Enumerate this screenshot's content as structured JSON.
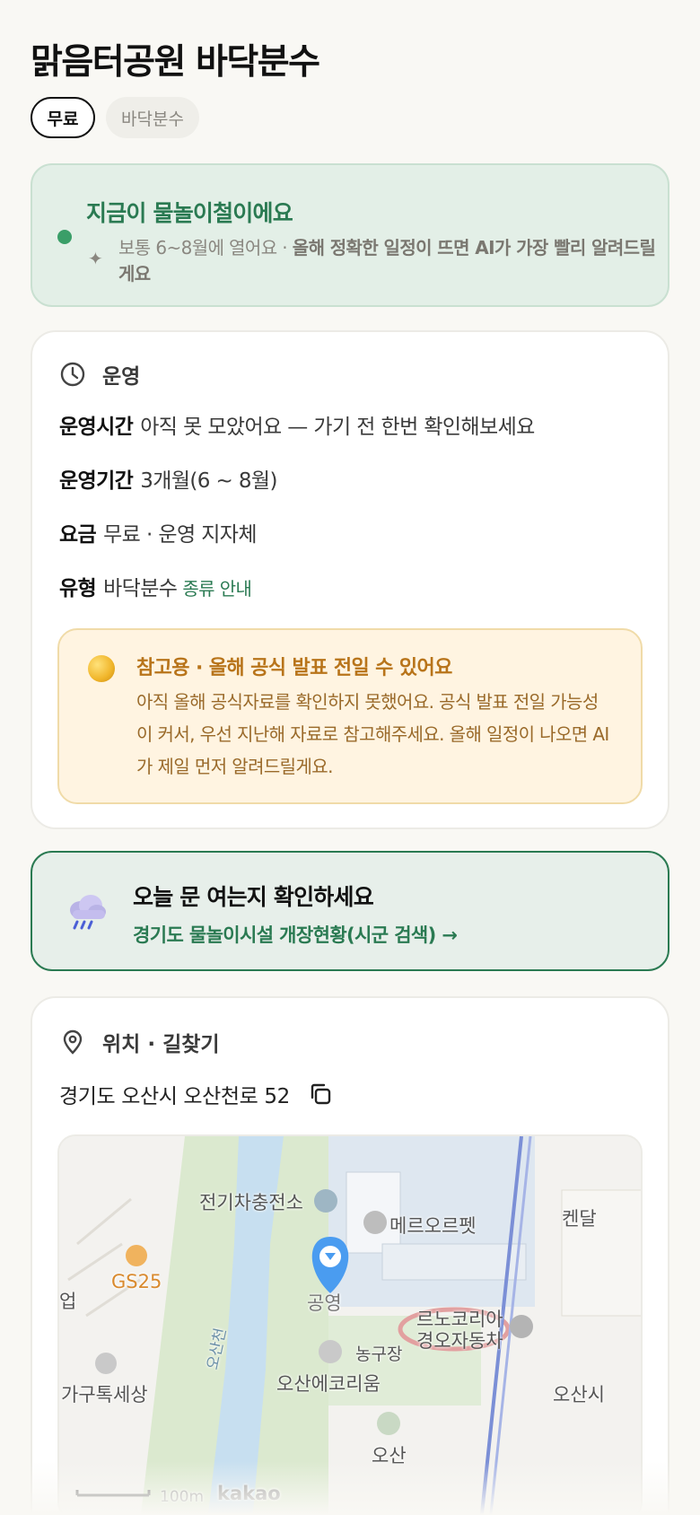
{
  "place": {
    "title": "맑음터공원 바닥분수"
  },
  "chips": {
    "free": "무료",
    "type": "바닥분수"
  },
  "season": {
    "heading": "지금이 물놀이철이에요",
    "text_plain": "보통 6~8월에 열어요 · ",
    "text_bold": "올해 정확한 일정이 뜨면 AI가 가장 빨리 알려드릴게요"
  },
  "operation": {
    "section_title": "운영",
    "hours_label": "운영시간",
    "hours_value": "아직 못 모았어요 — 가기 전 한번 확인해보세요",
    "period_label": "운영기간",
    "period_value": "3개월(6 ~ 8월)",
    "fee_label": "요금",
    "fee_value": "무료 · 운영 지자체",
    "type_label": "유형",
    "type_value": "바닥분수",
    "type_link": "종류 안내"
  },
  "notice": {
    "heading": "참고용 · 올해 공식 발표 전일 수 있어요",
    "body": "아직 올해 공식자료를 확인하지 못했어요. 공식 발표 전일 가능성이 커서, 우선 지난해 자료로 참고해주세요. 올해 일정이 나오면 AI가 제일 먼저 알려드릴게요."
  },
  "open_check": {
    "heading": "오늘 문 여는지 확인하세요",
    "link": "경기도 물놀이시설 개장현황(시군 검색) →"
  },
  "location": {
    "section_title": "위치 · 길찾기",
    "address": "경기도 오산시 오산천로 52"
  },
  "map": {
    "labels": {
      "ev": "전기차충전소",
      "mero": "메르오르펫",
      "kendal": "켄달",
      "gs25": "GS25",
      "up": "업",
      "park": "공영",
      "renault1": "르노코리아",
      "renault2": "경오자동차",
      "osancheon": "오산천",
      "court": "농구장",
      "ecorium": "오산에코리움",
      "furniture": "가구톡세상",
      "osansi": "오산시",
      "osan": "오산",
      "scale": "100m",
      "kakao": "kakao"
    }
  },
  "colors": {
    "accent_green": "#2a7a52",
    "notice_orange": "#b8741a",
    "pin_blue": "#4a9cf0"
  },
  "icons": {
    "season": "green-dot",
    "sparkle": "sparkle-icon",
    "clock": "clock-icon",
    "moon": "moon-icon",
    "rain_cloud": "rain-cloud-icon",
    "pin": "location-pin-icon",
    "copy": "copy-icon"
  }
}
